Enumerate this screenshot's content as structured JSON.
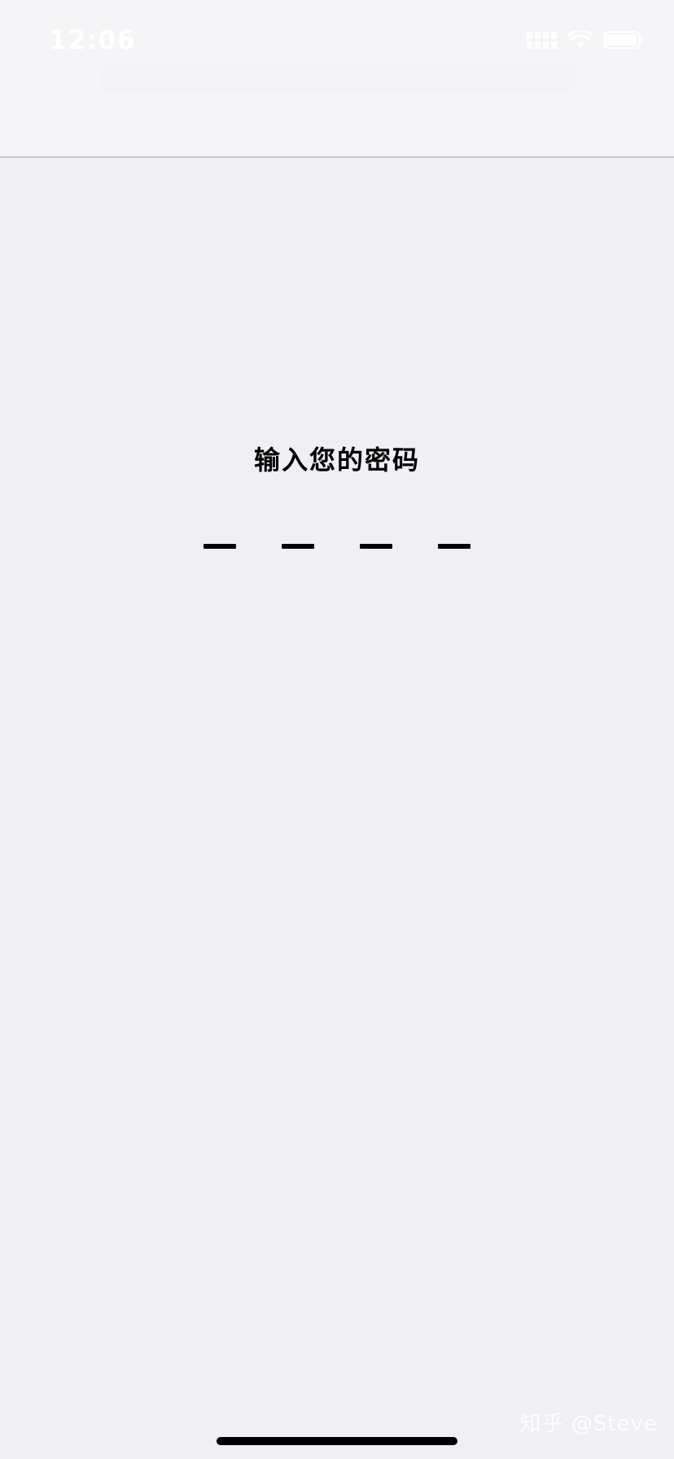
{
  "status_bar": {
    "time": "12:06",
    "icons": [
      "signal-icon",
      "wifi-icon",
      "battery-icon"
    ]
  },
  "passcode": {
    "title": "输入您的密码",
    "slot_count": 4
  },
  "watermark": {
    "text": "知乎 @Steve"
  },
  "colors": {
    "background": "#efeff4",
    "header": "#f5f5f7",
    "text": "#000000"
  }
}
